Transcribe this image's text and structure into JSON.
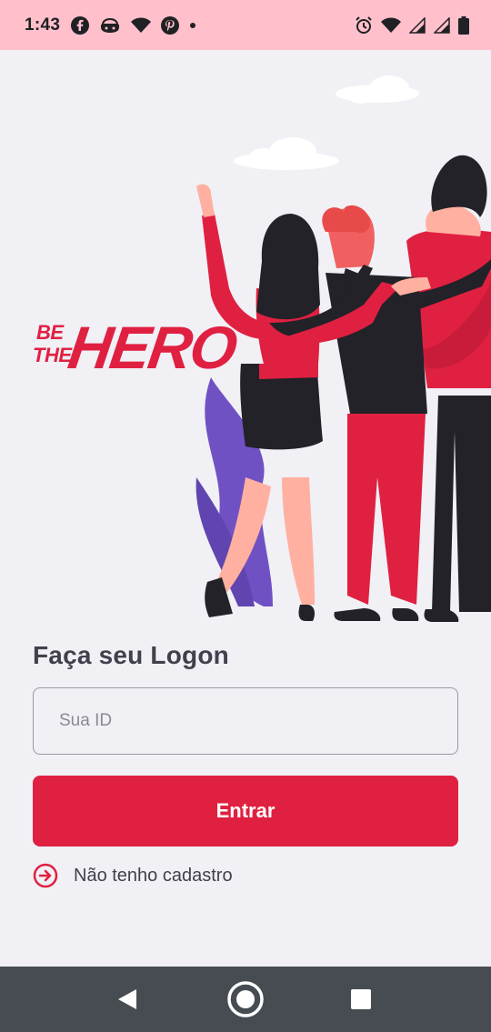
{
  "status_bar": {
    "time": "1:43",
    "left_icons": [
      "facebook-icon",
      "game-icon",
      "wifi-icon",
      "pinterest-icon",
      "dot-icon"
    ],
    "right_icons": [
      "alarm-icon",
      "wifi-icon",
      "signal-icon",
      "signal-icon",
      "battery-icon"
    ],
    "background": "#ffc0cb"
  },
  "logo": {
    "line1": "BE",
    "line2": "THE",
    "word": "HERO",
    "color": "#e02041"
  },
  "illustration": {
    "description_icon": "heroes-group-illustration"
  },
  "login": {
    "title": "Faça seu Logon",
    "id_placeholder": "Sua ID",
    "id_value": "",
    "submit_label": "Entrar",
    "register_link": "Não tenho cadastro",
    "accent_color": "#e02041"
  },
  "nav_bar": {
    "buttons": [
      "back-icon",
      "home-icon",
      "recents-icon"
    ],
    "background": "#464c52"
  }
}
